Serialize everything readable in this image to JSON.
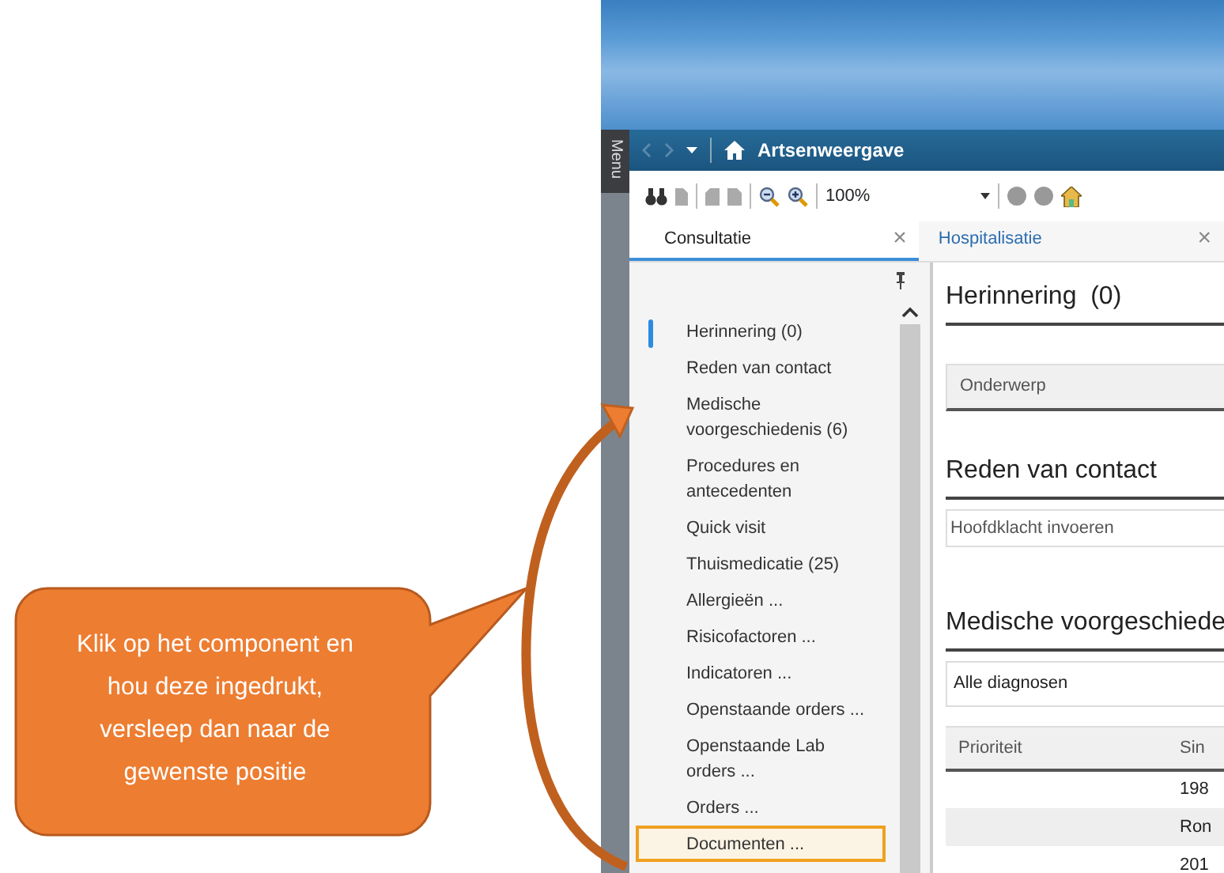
{
  "callout": {
    "text": "Klik op het component en hou deze ingedrukt, versleep dan naar de gewenste positie"
  },
  "window": {
    "title": "Artsenweergave",
    "menu_label": "Menu"
  },
  "toolbar": {
    "zoom": "100%"
  },
  "tabs": [
    {
      "label": "Consultatie",
      "close": "×",
      "selected": true
    },
    {
      "label": "Hospitalisatie",
      "close": "×",
      "selected": false
    }
  ],
  "sidebar": {
    "items": [
      {
        "label": "Herinnering (0)",
        "selected": true,
        "highlighted": false
      },
      {
        "label": "Reden van contact",
        "selected": false,
        "highlighted": false
      },
      {
        "label": "Medische voorgeschiedenis (6)",
        "selected": false,
        "highlighted": false
      },
      {
        "label": "Procedures en antecedenten",
        "selected": false,
        "highlighted": false
      },
      {
        "label": "Quick visit",
        "selected": false,
        "highlighted": false
      },
      {
        "label": "Thuismedicatie (25)",
        "selected": false,
        "highlighted": false
      },
      {
        "label": "Allergieën ...",
        "selected": false,
        "highlighted": false
      },
      {
        "label": "Risicofactoren ...",
        "selected": false,
        "highlighted": false
      },
      {
        "label": "Indicatoren ...",
        "selected": false,
        "highlighted": false
      },
      {
        "label": "Openstaande orders ...",
        "selected": false,
        "highlighted": false
      },
      {
        "label": "Openstaande Lab orders ...",
        "selected": false,
        "highlighted": false
      },
      {
        "label": "Orders ...",
        "selected": false,
        "highlighted": false
      },
      {
        "label": "Documenten ...",
        "selected": false,
        "highlighted": true
      }
    ]
  },
  "reminder": {
    "title": "Herinnering  (0)",
    "subject_column": "Onderwerp"
  },
  "contact": {
    "title": "Reden van contact",
    "placeholder": "Hoofdklacht invoeren"
  },
  "history": {
    "title": "Medische voorgeschiede",
    "filter": "Alle diagnosen",
    "columns": [
      "Prioriteit",
      "Sin"
    ],
    "rows": [
      {
        "column_2": "198"
      },
      {
        "column_2": "Ron"
      },
      {
        "column_2": "201"
      }
    ]
  }
}
